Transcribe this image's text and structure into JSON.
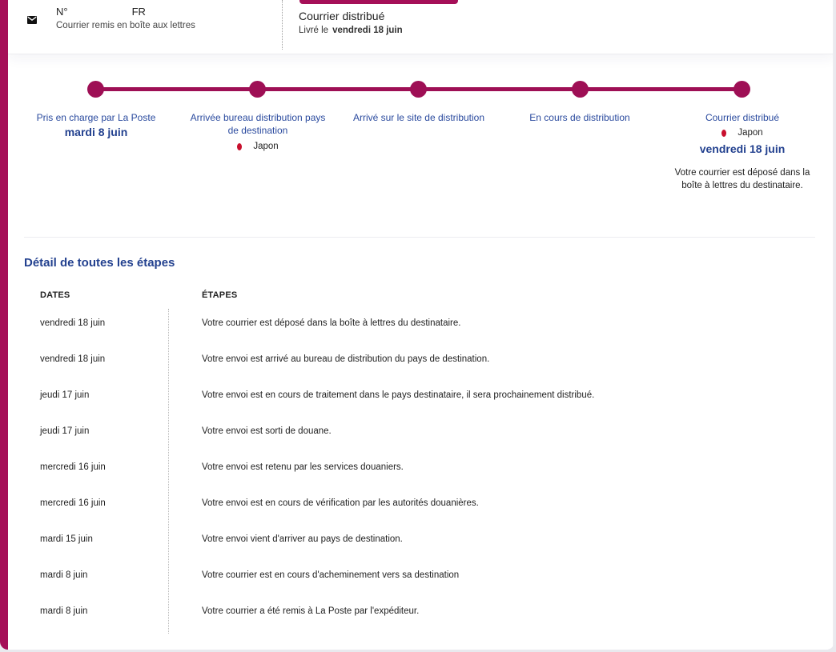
{
  "header": {
    "tracking_prefix": "N°",
    "tracking_suffix": "FR",
    "type_label": "Courrier remis en boîte aux lettres",
    "status_title": "Courrier distribué",
    "delivered_prefix": "Livré le",
    "delivered_date": "vendredi 18 juin",
    "icon": "mail-icon"
  },
  "timeline": {
    "steps": [
      {
        "label": "Pris en charge par La Poste",
        "date": "mardi 8 juin"
      },
      {
        "label": "Arrivée bureau distribution pays de destination",
        "country": "Japon"
      },
      {
        "label": "Arrivé sur le site de distribution"
      },
      {
        "label": "En cours de distribution"
      },
      {
        "label": "Courrier distribué",
        "country": "Japon",
        "date": "vendredi 18 juin",
        "message": "Votre courrier est déposé dans la boîte à lettres du destinataire."
      }
    ]
  },
  "details": {
    "title": "Détail de toutes les étapes",
    "col_dates": "DATES",
    "col_steps": "ÉTAPES",
    "rows": [
      {
        "date": "vendredi 18 juin",
        "step": "Votre courrier est déposé dans la boîte à lettres du destinataire."
      },
      {
        "date": "vendredi 18 juin",
        "step": "Votre envoi est arrivé au bureau de distribution du pays de destination."
      },
      {
        "date": "jeudi 17 juin",
        "step": "Votre envoi est en cours de traitement dans le pays destinataire, il sera prochainement distribué."
      },
      {
        "date": "jeudi 17 juin",
        "step": "Votre envoi est sorti de douane."
      },
      {
        "date": "mercredi 16 juin",
        "step": "Votre envoi est retenu par les services douaniers."
      },
      {
        "date": "mercredi 16 juin",
        "step": "Votre envoi est en cours de vérification par les autorités douanières."
      },
      {
        "date": "mardi 15 juin",
        "step": "Votre envoi vient d'arriver au pays de destination."
      },
      {
        "date": "mardi 8 juin",
        "step": "Votre courrier est en cours d'acheminement vers sa destination"
      },
      {
        "date": "mardi 8 juin",
        "step": "Votre courrier a été remis à La Poste par l'expéditeur."
      }
    ]
  },
  "colors": {
    "brand": "#a50f58",
    "link_blue": "#2a4a9e",
    "flag_red": "#c8102e"
  }
}
